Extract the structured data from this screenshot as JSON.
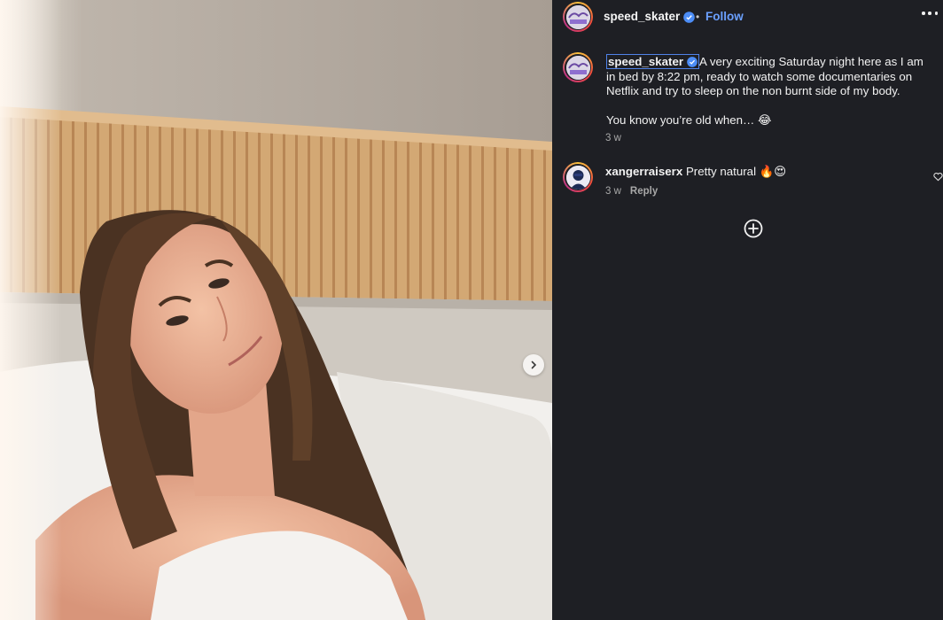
{
  "post": {
    "author": "speed_skater",
    "follow_label": "Follow",
    "dot_separator": "•",
    "caption_line1": "A very exciting Saturday night here as I am in bed by 8:22 pm, ready to watch some documentaries on Netflix and try to sleep on the non burnt side of my body.",
    "caption_line2": "You know you’re old when… 😂",
    "caption_time": "3 w"
  },
  "comments": [
    {
      "author": "xangerraiserx",
      "text": "Pretty natural 🔥😍",
      "time": "3 w",
      "reply_label": "Reply"
    }
  ],
  "icons": {
    "verified": "verified-badge-icon",
    "more": "more-options-icon",
    "next": "chevron-right-icon",
    "like": "heart-icon",
    "load_more": "plus-circle-icon"
  },
  "colors": {
    "panel_bg": "#1e1f24",
    "follow": "#6ba0ff",
    "verified": "#4c8df6",
    "meta": "#a8a8a8"
  }
}
